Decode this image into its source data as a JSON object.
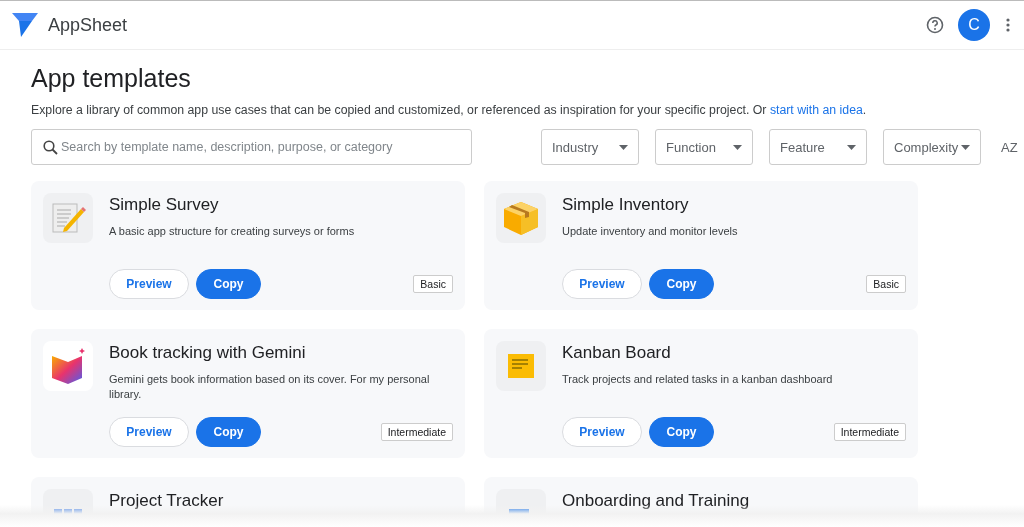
{
  "header": {
    "brand": "AppSheet",
    "avatar_initial": "C"
  },
  "page": {
    "title": "App templates",
    "description": "Explore a library of common app use cases that can be copied and customized, or referenced as inspiration for your specific project. Or ",
    "description_link": "start with an idea",
    "description_end": "."
  },
  "search": {
    "placeholder": "Search by template name, description, purpose, or category"
  },
  "filters": [
    "Industry",
    "Function",
    "Feature",
    "Complexity"
  ],
  "sort_label": "AZ",
  "templates": [
    {
      "kind": "survey",
      "title": "Simple Survey",
      "description": "A basic app structure for creating surveys or forms",
      "buttons": [
        "Preview",
        "Copy"
      ],
      "level": "Basic"
    },
    {
      "kind": "inventory",
      "title": "Simple Inventory",
      "description": "Update inventory and monitor levels",
      "buttons": [
        "Preview",
        "Copy"
      ],
      "level": "Basic"
    },
    {
      "kind": "book",
      "title": "Book tracking with Gemini",
      "description": "Gemini gets book information based on its cover. For my personal library.",
      "buttons": [
        "Preview",
        "Copy"
      ],
      "level": "Intermediate"
    },
    {
      "kind": "kanban",
      "title": "Kanban Board",
      "description": "Track projects and related tasks in a kanban dashboard",
      "buttons": [
        "Preview",
        "Copy"
      ],
      "level": "Intermediate"
    },
    {
      "kind": "project",
      "title": "Project Tracker"
    },
    {
      "kind": "onboarding",
      "title": "Onboarding and Training"
    }
  ]
}
